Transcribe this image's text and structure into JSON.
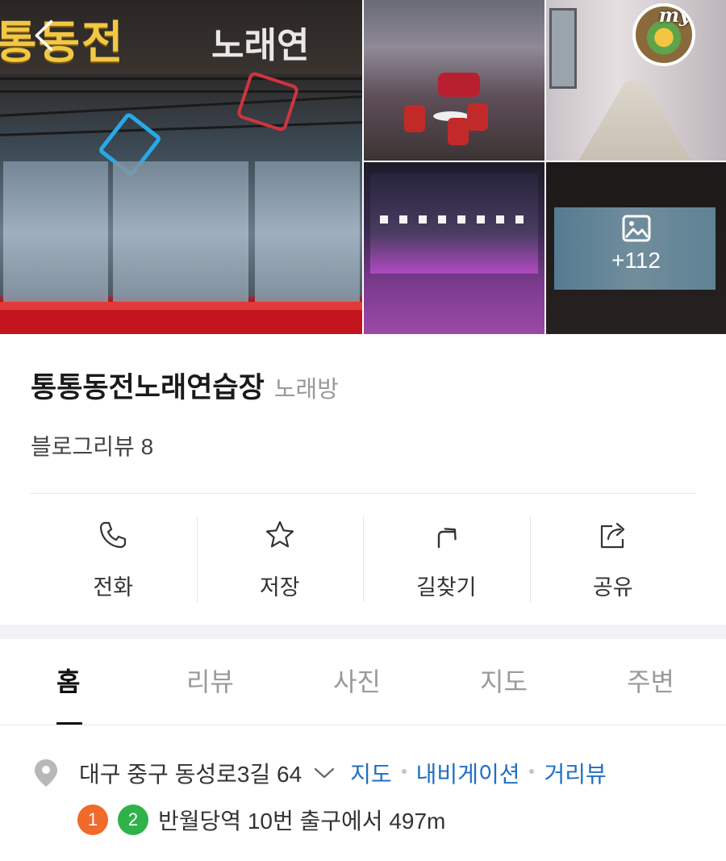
{
  "gallery": {
    "main_sign_text": "통동전",
    "main_sign_text2": "노래연",
    "more_count": "+112"
  },
  "header": {
    "my_badge_label": "my"
  },
  "place": {
    "name": "통통동전노래연습장",
    "category": "노래방",
    "review_count": "블로그리뷰 8"
  },
  "actions": [
    {
      "label": "전화",
      "icon": "phone-icon"
    },
    {
      "label": "저장",
      "icon": "star-icon"
    },
    {
      "label": "길찾기",
      "icon": "directions-icon"
    },
    {
      "label": "공유",
      "icon": "share-icon"
    }
  ],
  "tabs": [
    {
      "label": "홈",
      "active": true
    },
    {
      "label": "리뷰",
      "active": false
    },
    {
      "label": "사진",
      "active": false
    },
    {
      "label": "지도",
      "active": false
    },
    {
      "label": "주변",
      "active": false
    }
  ],
  "address": {
    "text": "대구 중구 동성로3길 64",
    "links": [
      "지도",
      "내비게이션",
      "거리뷰"
    ]
  },
  "subway": {
    "lines": [
      "1",
      "2"
    ],
    "line_colors": [
      "#f06a2a",
      "#2fb24a"
    ],
    "text": "반월당역 10번 출구에서 497m"
  },
  "colors": {
    "link": "#1f6fc4",
    "muted": "#999999",
    "divider": "#e6e6e6"
  }
}
